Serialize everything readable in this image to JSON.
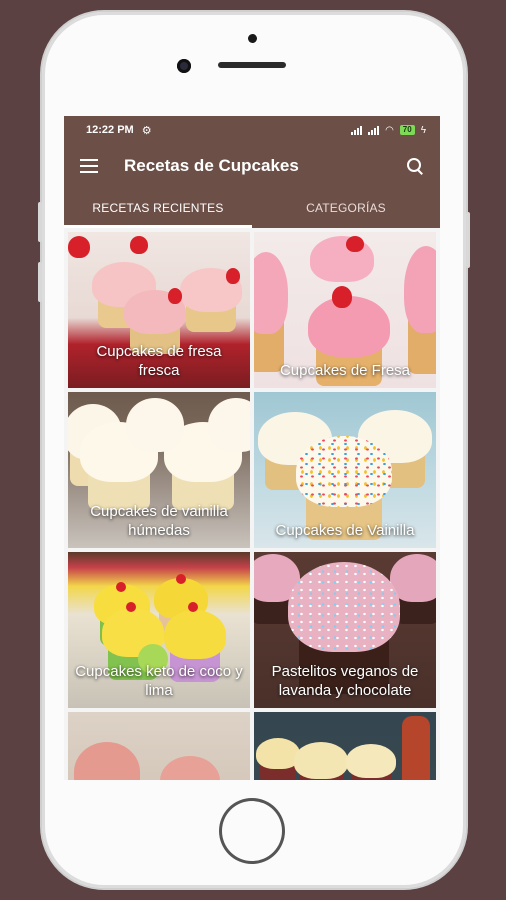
{
  "status_bar": {
    "time": "12:22 PM",
    "battery": "70"
  },
  "app_bar": {
    "title": "Recetas de Cupcakes"
  },
  "tabs": [
    {
      "label": "RECETAS RECIENTES",
      "active": true
    },
    {
      "label": "CATEGORÍAS",
      "active": false
    }
  ],
  "recipes": [
    {
      "title": "Cupcakes de fresa fresca"
    },
    {
      "title": "Cupcakes de Fresa"
    },
    {
      "title": "Cupcakes de vainilla húmedas"
    },
    {
      "title": "Cupcakes de Vainilla"
    },
    {
      "title": "Cupcakes keto de coco y lima"
    },
    {
      "title": "Pastelitos veganos de lavanda y chocolate"
    },
    {
      "title": ""
    },
    {
      "title": ""
    }
  ],
  "colors": {
    "primary": "#6c4f47",
    "background": "#5b4141",
    "tab_indicator": "#ffffff"
  },
  "icons": [
    "menu-icon",
    "search-icon",
    "settings-icon",
    "signal-icon",
    "wifi-icon",
    "battery-icon"
  ]
}
